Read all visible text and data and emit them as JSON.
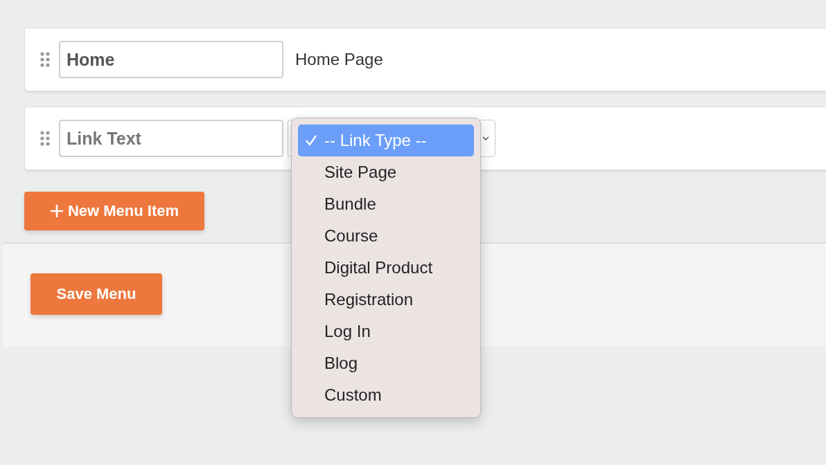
{
  "menu_items": [
    {
      "kind": "page",
      "link_text": {
        "value": "Home"
      },
      "link_label": "Home Page"
    },
    {
      "kind": "new",
      "link_text": {
        "placeholder": "Link Text"
      }
    }
  ],
  "link_type_dropdown": {
    "options": [
      {
        "label": "-- Link Type --",
        "selected": true
      },
      {
        "label": "Site Page",
        "selected": false
      },
      {
        "label": "Bundle",
        "selected": false
      },
      {
        "label": "Course",
        "selected": false
      },
      {
        "label": "Digital Product",
        "selected": false
      },
      {
        "label": "Registration",
        "selected": false
      },
      {
        "label": "Log In",
        "selected": false
      },
      {
        "label": "Blog",
        "selected": false
      },
      {
        "label": "Custom",
        "selected": false
      }
    ]
  },
  "add_button": {
    "label": "New Menu Item"
  },
  "save_button": {
    "label": "Save Menu"
  }
}
